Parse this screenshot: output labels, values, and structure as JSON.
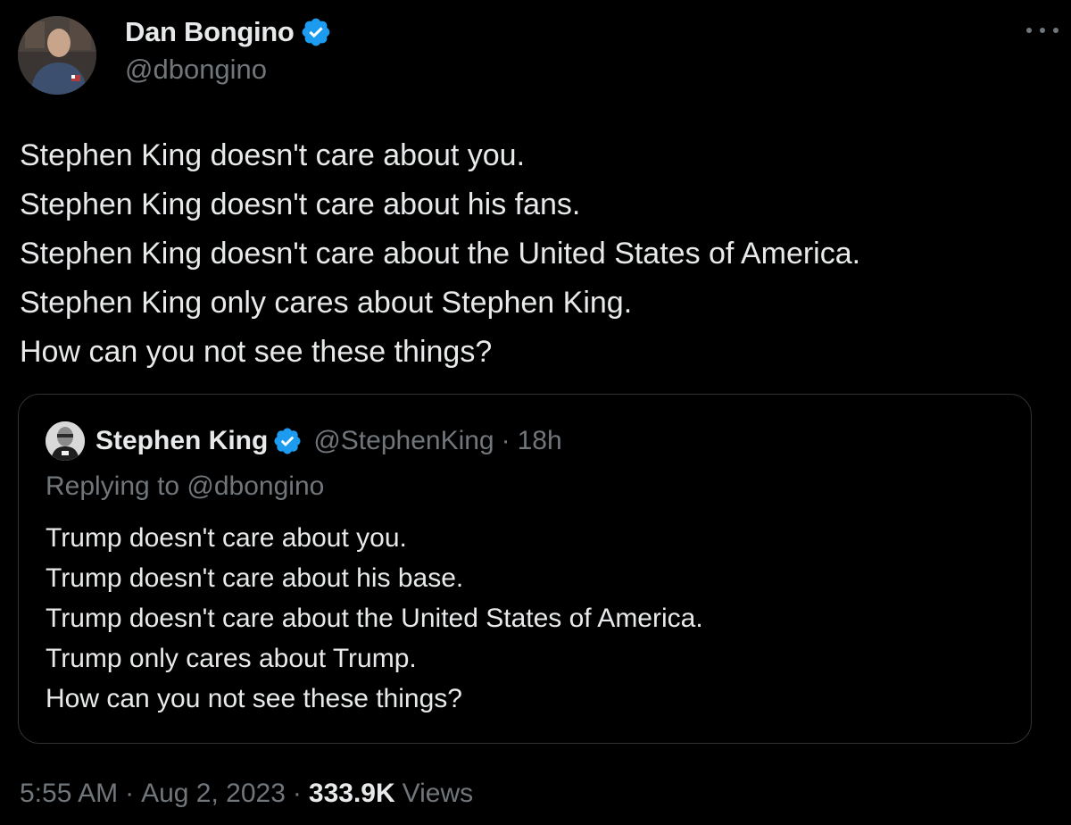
{
  "author": {
    "display_name": "Dan Bongino",
    "handle": "@dbongino",
    "verified": true
  },
  "tweet": {
    "lines": [
      "Stephen King doesn't care about you.",
      "Stephen King doesn't care about his fans.",
      "Stephen King doesn't care about the United States of America.",
      "Stephen King only cares about Stephen King.",
      "How can you not see these things?"
    ]
  },
  "quote": {
    "display_name": "Stephen King",
    "handle": "@StephenKing",
    "dot": "·",
    "time": "18h",
    "replying_to": "Replying to @dbongino",
    "lines": [
      "Trump doesn't care about you.",
      "Trump doesn't care about his base.",
      "Trump doesn't care about the United States of America.",
      "Trump only cares about Trump.",
      "How can you not see these things?"
    ]
  },
  "meta": {
    "time": "5:55 AM",
    "dot1": "·",
    "date": "Aug 2, 2023",
    "dot2": "·",
    "views_count": "333.9K",
    "views_label": "Views"
  },
  "icons": {
    "more": "more-horizontal-icon",
    "verified": "verified-badge-icon"
  },
  "colors": {
    "background": "#000000",
    "text_primary": "#e7e9ea",
    "text_secondary": "#71767b",
    "verified_blue": "#1d9bf0",
    "border": "#2f3336"
  }
}
